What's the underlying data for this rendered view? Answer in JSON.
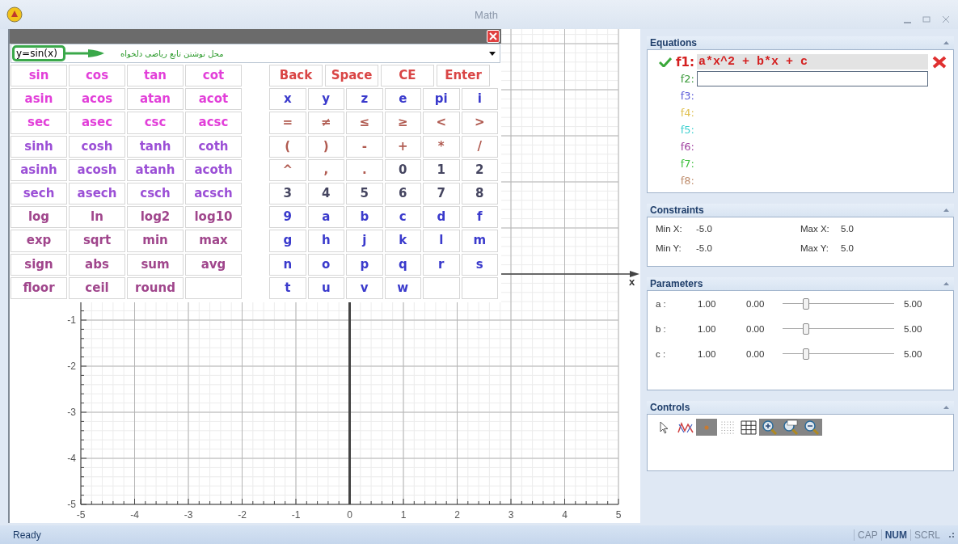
{
  "window": {
    "title": "Math"
  },
  "keypad": {
    "input": {
      "value": "y=sin(x)"
    },
    "hint": "محل نوشتن تابع ریاضی دلخواه",
    "function_rows": [
      [
        {
          "kind": "key",
          "label": "sin",
          "color": "#e23fd9"
        },
        {
          "kind": "key",
          "label": "cos",
          "color": "#e23fd9"
        },
        {
          "kind": "key",
          "label": "tan",
          "color": "#e23fd9"
        },
        {
          "kind": "key",
          "label": "cot",
          "color": "#e23fd9"
        }
      ],
      [
        {
          "kind": "key",
          "label": "asin",
          "color": "#e23fd9"
        },
        {
          "kind": "key",
          "label": "acos",
          "color": "#e23fd9"
        },
        {
          "kind": "key",
          "label": "atan",
          "color": "#e23fd9"
        },
        {
          "kind": "key",
          "label": "acot",
          "color": "#e23fd9"
        }
      ],
      [
        {
          "kind": "key",
          "label": "sec",
          "color": "#e23fd9"
        },
        {
          "kind": "key",
          "label": "asec",
          "color": "#e23fd9"
        },
        {
          "kind": "key",
          "label": "csc",
          "color": "#e23fd9"
        },
        {
          "kind": "key",
          "label": "acsc",
          "color": "#e23fd9"
        }
      ],
      [
        {
          "kind": "key",
          "label": "sinh",
          "color": "#9b4fd6"
        },
        {
          "kind": "key",
          "label": "cosh",
          "color": "#9b4fd6"
        },
        {
          "kind": "key",
          "label": "tanh",
          "color": "#9b4fd6"
        },
        {
          "kind": "key",
          "label": "coth",
          "color": "#9b4fd6"
        }
      ],
      [
        {
          "kind": "key",
          "label": "asinh",
          "color": "#9b4fd6"
        },
        {
          "kind": "key",
          "label": "acosh",
          "color": "#9b4fd6"
        },
        {
          "kind": "key",
          "label": "atanh",
          "color": "#9b4fd6"
        },
        {
          "kind": "key",
          "label": "acoth",
          "color": "#9b4fd6"
        }
      ],
      [
        {
          "kind": "key",
          "label": "sech",
          "color": "#9b4fd6"
        },
        {
          "kind": "key",
          "label": "asech",
          "color": "#9b4fd6"
        },
        {
          "kind": "key",
          "label": "csch",
          "color": "#9b4fd6"
        },
        {
          "kind": "key",
          "label": "acsch",
          "color": "#9b4fd6"
        }
      ],
      [
        {
          "kind": "key",
          "label": "log",
          "color": "#a0468c"
        },
        {
          "kind": "key",
          "label": "ln",
          "color": "#a0468c"
        },
        {
          "kind": "key",
          "label": "log2",
          "color": "#a0468c"
        },
        {
          "kind": "key",
          "label": "log10",
          "color": "#a0468c"
        }
      ],
      [
        {
          "kind": "key",
          "label": "exp",
          "color": "#a0468c"
        },
        {
          "kind": "key",
          "label": "sqrt",
          "color": "#a0468c"
        },
        {
          "kind": "key",
          "label": "min",
          "color": "#a0468c"
        },
        {
          "kind": "key",
          "label": "max",
          "color": "#a0468c"
        }
      ],
      [
        {
          "kind": "key",
          "label": "sign",
          "color": "#a0468c"
        },
        {
          "kind": "key",
          "label": "abs",
          "color": "#a0468c"
        },
        {
          "kind": "key",
          "label": "sum",
          "color": "#a0468c"
        },
        {
          "kind": "key",
          "label": "avg",
          "color": "#a0468c"
        }
      ],
      [
        {
          "kind": "key",
          "label": "floor",
          "color": "#a0468c"
        },
        {
          "kind": "key",
          "label": "ceil",
          "color": "#a0468c"
        },
        {
          "kind": "key",
          "label": "round",
          "color": "#a0468c"
        },
        {
          "kind": "blank"
        }
      ]
    ],
    "command_keys": [
      {
        "label": "Back",
        "color": "#d94545"
      },
      {
        "label": "Space",
        "color": "#d94545"
      },
      {
        "label": "CE",
        "color": "#d94545"
      },
      {
        "label": "Enter",
        "color": "#d94545"
      }
    ],
    "symbol_rows": [
      [
        {
          "kind": "key",
          "label": "x",
          "color": "#3a3acc"
        },
        {
          "kind": "key",
          "label": "y",
          "color": "#3a3acc"
        },
        {
          "kind": "key",
          "label": "z",
          "color": "#3a3acc"
        },
        {
          "kind": "key",
          "label": "e",
          "color": "#3a3acc"
        },
        {
          "kind": "key",
          "label": "pi",
          "color": "#3a3acc"
        },
        {
          "kind": "key",
          "label": "i",
          "color": "#3a3acc"
        }
      ],
      [
        {
          "kind": "key",
          "label": "=",
          "color": "#b05a50"
        },
        {
          "kind": "key",
          "label": "≠",
          "color": "#b05a50"
        },
        {
          "kind": "key",
          "label": "≤",
          "color": "#b05a50"
        },
        {
          "kind": "key",
          "label": "≥",
          "color": "#b05a50"
        },
        {
          "kind": "key",
          "label": "<",
          "color": "#b05a50"
        },
        {
          "kind": "key",
          "label": ">",
          "color": "#b05a50"
        }
      ],
      [
        {
          "kind": "key",
          "label": "(",
          "color": "#b05a50"
        },
        {
          "kind": "key",
          "label": ")",
          "color": "#b05a50"
        },
        {
          "kind": "key",
          "label": "-",
          "color": "#b05a50"
        },
        {
          "kind": "key",
          "label": "+",
          "color": "#b05a50"
        },
        {
          "kind": "key",
          "label": "*",
          "color": "#b05a50"
        },
        {
          "kind": "key",
          "label": "/",
          "color": "#b05a50"
        }
      ],
      [
        {
          "kind": "key",
          "label": "^",
          "color": "#b05a50"
        },
        {
          "kind": "key",
          "label": ",",
          "color": "#b05a50"
        },
        {
          "kind": "key",
          "label": ".",
          "color": "#b05a50"
        },
        {
          "kind": "key",
          "label": "0",
          "color": "#454560"
        },
        {
          "kind": "key",
          "label": "1",
          "color": "#454560"
        },
        {
          "kind": "key",
          "label": "2",
          "color": "#454560"
        }
      ],
      [
        {
          "kind": "key",
          "label": "3",
          "color": "#454560"
        },
        {
          "kind": "key",
          "label": "4",
          "color": "#454560"
        },
        {
          "kind": "key",
          "label": "5",
          "color": "#454560"
        },
        {
          "kind": "key",
          "label": "6",
          "color": "#454560"
        },
        {
          "kind": "key",
          "label": "7",
          "color": "#454560"
        },
        {
          "kind": "key",
          "label": "8",
          "color": "#454560"
        }
      ],
      [
        {
          "kind": "key",
          "label": "9",
          "color": "#3a3acc"
        },
        {
          "kind": "key",
          "label": "a",
          "color": "#3a3acc"
        },
        {
          "kind": "key",
          "label": "b",
          "color": "#3a3acc"
        },
        {
          "kind": "key",
          "label": "c",
          "color": "#3a3acc"
        },
        {
          "kind": "key",
          "label": "d",
          "color": "#3a3acc"
        },
        {
          "kind": "key",
          "label": "f",
          "color": "#3a3acc"
        }
      ],
      [
        {
          "kind": "key",
          "label": "g",
          "color": "#3a3acc"
        },
        {
          "kind": "key",
          "label": "h",
          "color": "#3a3acc"
        },
        {
          "kind": "key",
          "label": "j",
          "color": "#3a3acc"
        },
        {
          "kind": "key",
          "label": "k",
          "color": "#3a3acc"
        },
        {
          "kind": "key",
          "label": "l",
          "color": "#3a3acc"
        },
        {
          "kind": "key",
          "label": "m",
          "color": "#3a3acc"
        }
      ],
      [
        {
          "kind": "key",
          "label": "n",
          "color": "#3a3acc"
        },
        {
          "kind": "key",
          "label": "o",
          "color": "#3a3acc"
        },
        {
          "kind": "key",
          "label": "p",
          "color": "#3a3acc"
        },
        {
          "kind": "key",
          "label": "q",
          "color": "#3a3acc"
        },
        {
          "kind": "key",
          "label": "r",
          "color": "#3a3acc"
        },
        {
          "kind": "key",
          "label": "s",
          "color": "#3a3acc"
        }
      ],
      [
        {
          "kind": "key",
          "label": "t",
          "color": "#3a3acc"
        },
        {
          "kind": "key",
          "label": "u",
          "color": "#3a3acc"
        },
        {
          "kind": "key",
          "label": "v",
          "color": "#3a3acc"
        },
        {
          "kind": "key",
          "label": "w",
          "color": "#3a3acc"
        },
        {
          "kind": "blank"
        },
        {
          "kind": "blank"
        }
      ]
    ]
  },
  "graph": {
    "chart_data": {
      "type": "line",
      "grid": true,
      "xlabel": "x",
      "xlim": [
        -5,
        5
      ],
      "ylim": [
        -5,
        5
      ],
      "xticks": [
        -5,
        -4,
        -3,
        -2,
        -1,
        0,
        1,
        2,
        3,
        4,
        5
      ],
      "yticks": [
        -5,
        -4,
        -3,
        -2,
        -1
      ]
    }
  },
  "equations": {
    "title": "Equations",
    "items": [
      {
        "kind": "formula",
        "label": "f1:",
        "color": "#d42020",
        "expression": "a*x^2 + b*x + c",
        "valid": true
      },
      {
        "kind": "input",
        "label": "f2:",
        "color": "#3a9a3a"
      },
      {
        "kind": "empty",
        "label": "f3:",
        "color": "#5a5ad8"
      },
      {
        "kind": "empty",
        "label": "f4:",
        "color": "#e0c050"
      },
      {
        "kind": "empty",
        "label": "f5:",
        "color": "#40d0d0"
      },
      {
        "kind": "empty",
        "label": "f6:",
        "color": "#a040a0"
      },
      {
        "kind": "empty",
        "label": "f7:",
        "color": "#40c040"
      },
      {
        "kind": "empty",
        "label": "f8:",
        "color": "#c09070"
      }
    ]
  },
  "constraints": {
    "title": "Constraints",
    "fields": [
      {
        "label": "Min X:",
        "value": "-5.0"
      },
      {
        "label": "Max X:",
        "value": "5.0"
      },
      {
        "label": "Min Y:",
        "value": "-5.0"
      },
      {
        "label": "Max Y:",
        "value": "5.0"
      }
    ]
  },
  "parameters": {
    "title": "Parameters",
    "items": [
      {
        "name": "a :",
        "value": "1.00",
        "min": "0.00",
        "max": "5.00",
        "level": 0.2
      },
      {
        "name": "b :",
        "value": "1.00",
        "min": "0.00",
        "max": "5.00",
        "level": 0.2
      },
      {
        "name": "c :",
        "value": "1.00",
        "min": "0.00",
        "max": "5.00",
        "level": 0.2
      }
    ]
  },
  "controls": {
    "title": "Controls",
    "tools": [
      {
        "kind": "pointer",
        "selected": false
      },
      {
        "kind": "trace",
        "selected": false
      },
      {
        "kind": "point",
        "selected": true
      },
      {
        "kind": "dots",
        "selected": false
      },
      {
        "kind": "grid",
        "selected": false
      },
      {
        "kind": "zoom_in",
        "selected": true
      },
      {
        "kind": "zoom_reset",
        "selected": true
      },
      {
        "kind": "zoom_out",
        "selected": true
      }
    ]
  },
  "status_bar": {
    "text": "Ready",
    "indicators": [
      {
        "label": "CAP",
        "on": false
      },
      {
        "label": "NUM",
        "on": true
      },
      {
        "label": "SCRL",
        "on": false
      }
    ]
  }
}
